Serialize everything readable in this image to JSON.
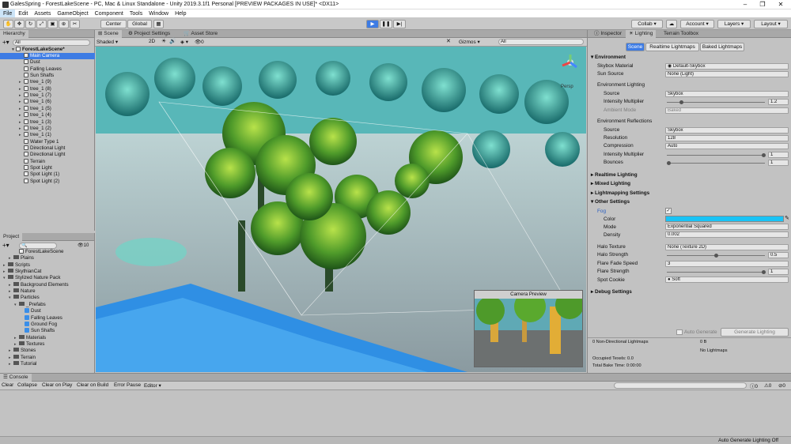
{
  "window": {
    "title": "GalesSpring - ForestLakeScene - PC, Mac & Linux Standalone - Unity 2019.3.1f1 Personal [PREVIEW PACKAGES IN USE]* <DX11>"
  },
  "menu": [
    "File",
    "Edit",
    "Assets",
    "GameObject",
    "Component",
    "Tools",
    "Window",
    "Help"
  ],
  "toolbar": {
    "center": "Center",
    "global": "Global",
    "collab": "Collab",
    "account": "Account",
    "layers": "Layers",
    "layout": "Layout"
  },
  "hierarchy": {
    "tab": "Hierarchy",
    "search": "All",
    "scene": "ForestLakeScene*",
    "items": [
      "Main Camera",
      "Dust",
      "Falling Leaves",
      "Sun Shafts",
      "tree_1 (9)",
      "tree_1 (8)",
      "tree_1 (7)",
      "tree_1 (6)",
      "tree_1 (5)",
      "tree_1 (4)",
      "tree_1 (3)",
      "tree_1 (2)",
      "tree_1 (1)",
      "Water Type 1",
      "Directional Light",
      "Directional Light",
      "Terrain",
      "Spot Light",
      "Spot Light (1)",
      "Spot Light (2)"
    ]
  },
  "project": {
    "tab": "Project",
    "count": "10",
    "items": [
      "ForestLakeScene",
      "Plains",
      "Scripts",
      "SkythianCat",
      "Stylized Nature Pack",
      "Background Elements",
      "Nature",
      "Particles",
      "_Prefabs",
      "Dust",
      "Falling Leaves",
      "Ground Fog",
      "Sun Shafts",
      "Materials",
      "Textures",
      "Stones",
      "Terrain",
      "Tutorial"
    ]
  },
  "scene": {
    "tabs": [
      "Scene",
      "Project Settings",
      "Asset Store"
    ],
    "shading": "Shaded",
    "twod": "2D",
    "gizmos": "Gizmos",
    "search": "All",
    "persp": "Persp",
    "camera_preview": "Camera Preview",
    "fx_count": "0"
  },
  "inspector": {
    "tabs": [
      "Inspector",
      "Lighting",
      "Terrain Toolbox"
    ],
    "subtabs": [
      "Scene",
      "Realtime Lightmaps",
      "Baked Lightmaps"
    ],
    "environment": "Environment",
    "skybox_material_label": "Skybox Material",
    "skybox_material": "Default-Skybox",
    "sun_source_label": "Sun Source",
    "sun_source": "None (Light)",
    "env_lighting": "Environment Lighting",
    "source_label": "Source",
    "source": "Skybox",
    "intensity_label": "Intensity Multiplier",
    "intensity": "1.2",
    "ambient_mode_label": "Ambient Mode",
    "ambient_mode": "Baked",
    "env_reflections": "Environment Reflections",
    "refl_source": "Skybox",
    "resolution_label": "Resolution",
    "resolution": "128",
    "compression_label": "Compression",
    "compression": "Auto",
    "refl_intensity": "1",
    "bounces_label": "Bounces",
    "bounces": "1",
    "realtime": "Realtime Lighting",
    "mixed": "Mixed Lighting",
    "lightmapping": "Lightmapping Settings",
    "other": "Other Settings",
    "fog_label": "Fog",
    "color_label": "Color",
    "fog_color": "#19c3f5",
    "mode_label": "Mode",
    "mode": "Exponential Squared",
    "density_label": "Density",
    "density": "0.002",
    "halo_texture_label": "Halo Texture",
    "halo_texture": "None (Texture 2D)",
    "halo_strength_label": "Halo Strength",
    "halo_strength": "0.5",
    "flare_fade_label": "Flare Fade Speed",
    "flare_fade": "3",
    "flare_strength_label": "Flare Strength",
    "flare_strength": "1",
    "spot_cookie_label": "Spot Cookie",
    "spot_cookie": "Soft",
    "debug": "Debug Settings",
    "auto_generate": "Auto Generate",
    "generate_lighting": "Generate Lighting",
    "stats": [
      "0 Non-Directional Lightmaps",
      "0 B",
      "No Lightmaps",
      "Occupied Texels: 0.0",
      "Total Bake Time: 0:00:00"
    ]
  },
  "console": {
    "tab": "Console",
    "buttons": [
      "Clear",
      "Collapse",
      "Clear on Play",
      "Clear on Build",
      "Error Pause",
      "Editor"
    ],
    "counts": [
      "0",
      "0",
      "0"
    ]
  },
  "status": {
    "text": "Auto Generate Lighting Off"
  }
}
